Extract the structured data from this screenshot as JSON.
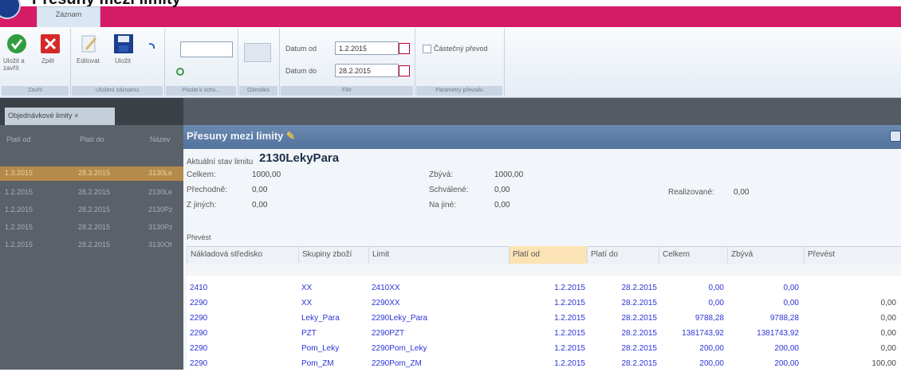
{
  "header": {
    "doc_title": "Přesuny mezi limity",
    "ribbon_tab": "Záznam"
  },
  "ribbon": {
    "save_close": "Uložit a zavřít",
    "back": "Zpět",
    "edit": "Editovat",
    "save": "Uložit",
    "date_from_label": "Datum od",
    "date_from": "1.2.2015",
    "date_to_label": "Datum do",
    "date_to": "28.2.2015",
    "partial_transfer": "Částečný převod",
    "group_labels": [
      "Zavřít",
      "Uložení záznamu",
      "Poslat k schv...",
      "Odeslání",
      "Filtr",
      "Parametry převodu"
    ]
  },
  "doc_tab": "Objednávkové limity",
  "background_grid": {
    "headers": [
      "Platí od",
      "Platí do",
      "Název"
    ],
    "rows": [
      [
        "1.3.2015",
        "28.3.2015",
        "3130Le"
      ],
      [
        "1.2.2015",
        "28.2.2015",
        "2130Le"
      ],
      [
        "1.2.2015",
        "28.2.2015",
        "2130Pz"
      ],
      [
        "1.2.2015",
        "28.2.2015",
        "3130Pz"
      ],
      [
        "1.2.2015",
        "28.2.2015",
        "3130Ot"
      ]
    ]
  },
  "modal": {
    "title": "Přesuny mezi limity",
    "state_label": "Aktuální stav limitu",
    "limit_name": "2130LekyPara",
    "summary": {
      "celkem_label": "Celkem:",
      "celkem": "1000,00",
      "prechodne_label": "Přechodně:",
      "prechodne": "0,00",
      "z_jinych_label": "Z jiných:",
      "z_jinych": "0,00",
      "zbyva_label": "Zbývá:",
      "zbyva": "1000,00",
      "schvalene_label": "Schválené:",
      "schvalene": "0,00",
      "na_jine_label": "Na jiné:",
      "na_jine": "0,00",
      "realizovane_label": "Realizované:",
      "realizovane": "0,00"
    },
    "prevest_label": "Převést",
    "columns": [
      "Nákladová středisko",
      "Skupiny zboží",
      "Limit",
      "Platí od",
      "Platí do",
      "Celkem",
      "Zbývá",
      "Převést"
    ],
    "rows": [
      {
        "ns": "2410",
        "sk": "XX",
        "limit": "2410XX",
        "od": "1.2.2015",
        "do": "28.2.2015",
        "celkem": "0,00",
        "zbyva": "0,00",
        "prevest": ""
      },
      {
        "ns": "2290",
        "sk": "XX",
        "limit": "2290XX",
        "od": "1.2.2015",
        "do": "28.2.2015",
        "celkem": "0,00",
        "zbyva": "0,00",
        "prevest": "0,00"
      },
      {
        "ns": "2290",
        "sk": "Leky_Para",
        "limit": "2290Leky_Para",
        "od": "1.2.2015",
        "do": "28.2.2015",
        "celkem": "9788,28",
        "zbyva": "9788,28",
        "prevest": "0,00"
      },
      {
        "ns": "2290",
        "sk": "PZT",
        "limit": "2290PZT",
        "od": "1.2.2015",
        "do": "28.2.2015",
        "celkem": "1381743,92",
        "zbyva": "1381743,92",
        "prevest": "0,00"
      },
      {
        "ns": "2290",
        "sk": "Pom_Leky",
        "limit": "2290Pom_Leky",
        "od": "1.2.2015",
        "do": "28.2.2015",
        "celkem": "200,00",
        "zbyva": "200,00",
        "prevest": "0,00"
      },
      {
        "ns": "2290",
        "sk": "Pom_ZM",
        "limit": "2290Pom_ZM",
        "od": "1.2.2015",
        "do": "28.2.2015",
        "celkem": "200,00",
        "zbyva": "200,00",
        "prevest": "100,00"
      }
    ]
  },
  "colors": {
    "title_bar": "#d51a66",
    "modal_title": "#5b7aa5",
    "row_text": "#2b33d6"
  }
}
